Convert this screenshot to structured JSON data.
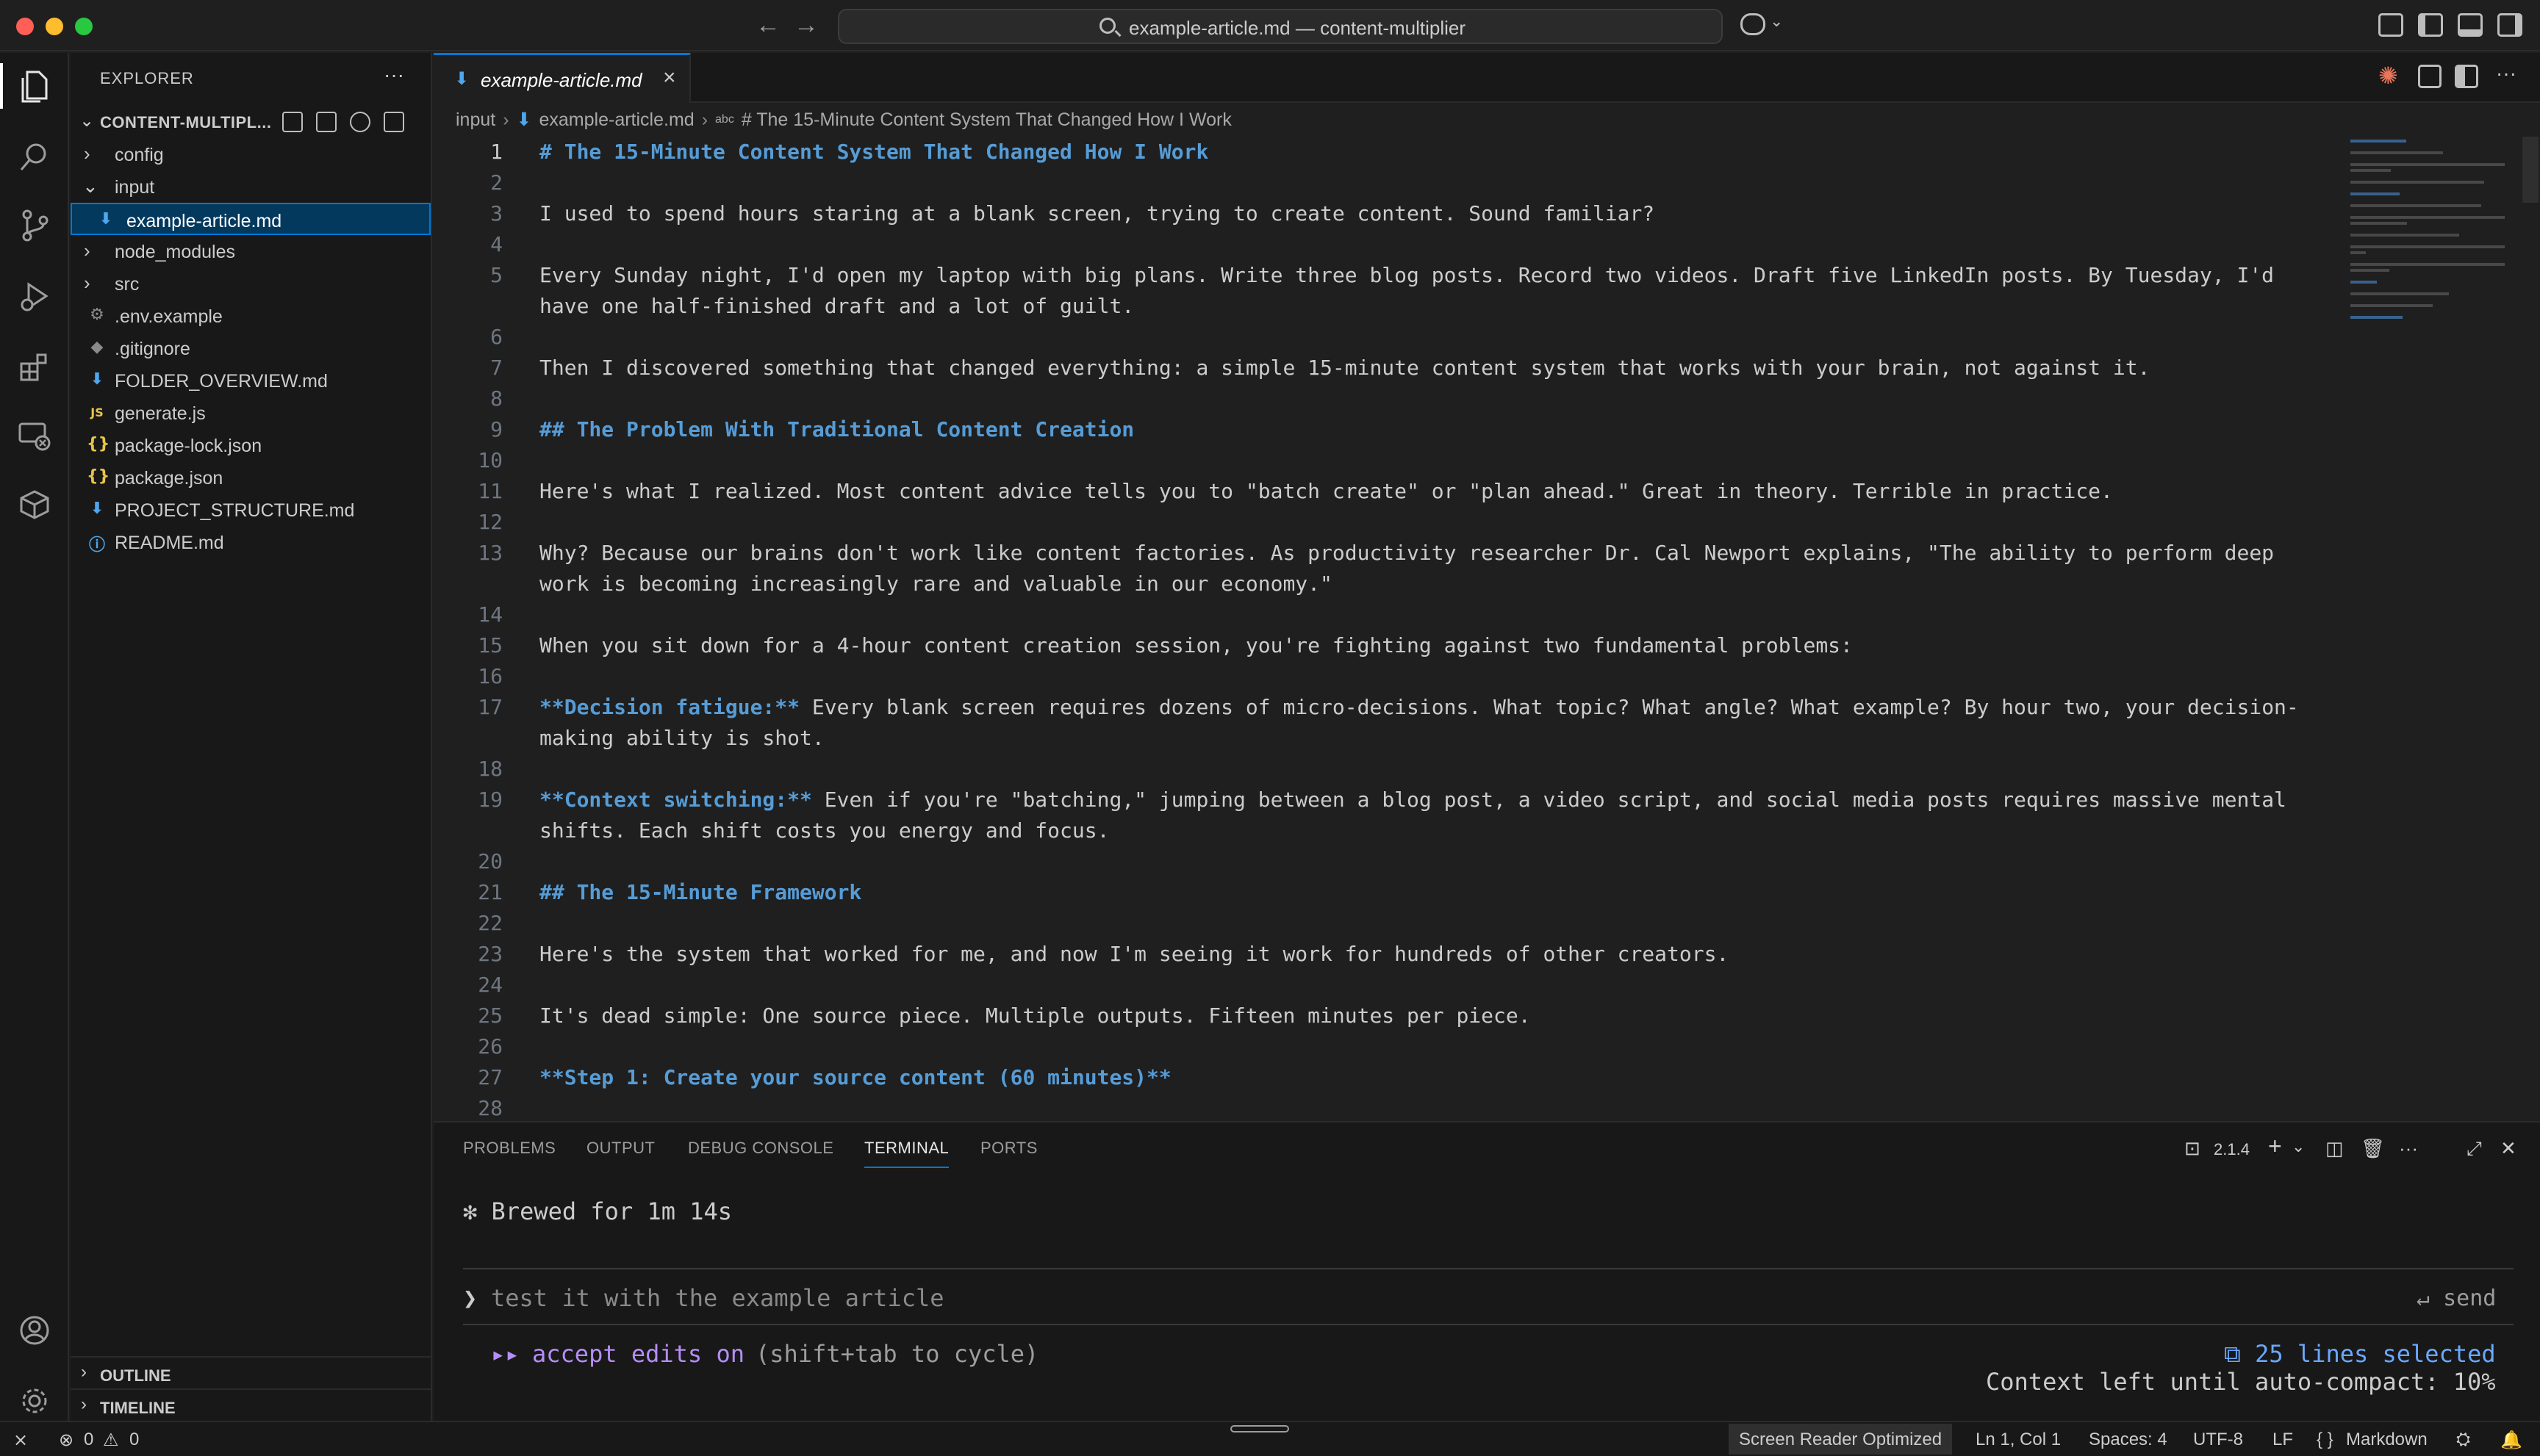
{
  "titlebar": {
    "search_text": "example-article.md — content-multiplier",
    "back": "←",
    "forward": "→"
  },
  "sidebar": {
    "title": "EXPLORER",
    "more": "···",
    "root": "CONTENT-MULTIPL...",
    "items": [
      {
        "label": "config",
        "type": "folder",
        "state": "collapsed"
      },
      {
        "label": "input",
        "type": "folder",
        "state": "expanded"
      },
      {
        "label": "example-article.md",
        "type": "markdown",
        "selected": true
      },
      {
        "label": "node_modules",
        "type": "folder",
        "state": "collapsed"
      },
      {
        "label": "src",
        "type": "folder",
        "state": "collapsed"
      },
      {
        "label": ".env.example",
        "type": "env"
      },
      {
        "label": ".gitignore",
        "type": "gitignore"
      },
      {
        "label": "FOLDER_OVERVIEW.md",
        "type": "markdown"
      },
      {
        "label": "generate.js",
        "type": "js"
      },
      {
        "label": "package-lock.json",
        "type": "json"
      },
      {
        "label": "package.json",
        "type": "json"
      },
      {
        "label": "PROJECT_STRUCTURE.md",
        "type": "markdown"
      },
      {
        "label": "README.md",
        "type": "info"
      }
    ],
    "outline": "OUTLINE",
    "timeline": "TIMELINE"
  },
  "editor": {
    "tab_label": "example-article.md",
    "breadcrumb": [
      "input",
      "example-article.md",
      "# The 15-Minute Content System That Changed How I Work"
    ],
    "active_line": 1,
    "lines": [
      {
        "n": "1",
        "text": "# The 15-Minute Content System That Changed How I Work",
        "kind": "heading"
      },
      {
        "n": "2",
        "text": ""
      },
      {
        "n": "3",
        "text": "I used to spend hours staring at a blank screen, trying to create content. Sound familiar?"
      },
      {
        "n": "4",
        "text": ""
      },
      {
        "n": "5",
        "text": "Every Sunday night, I'd open my laptop with big plans. Write three blog posts. Record two videos. Draft five LinkedIn posts. By Tuesday, I'd have one half-finished draft and a lot of guilt."
      },
      {
        "n": "6",
        "text": ""
      },
      {
        "n": "7",
        "text": "Then I discovered something that changed everything: a simple 15-minute content system that works with your brain, not against it."
      },
      {
        "n": "8",
        "text": ""
      },
      {
        "n": "9",
        "text": "## The Problem With Traditional Content Creation",
        "kind": "heading"
      },
      {
        "n": "10",
        "text": ""
      },
      {
        "n": "11",
        "text": "Here's what I realized. Most content advice tells you to \"batch create\" or \"plan ahead.\" Great in theory. Terrible in practice."
      },
      {
        "n": "12",
        "text": ""
      },
      {
        "n": "13",
        "text": "Why? Because our brains don't work like content factories. As productivity researcher Dr. Cal Newport explains, \"The ability to perform deep work is becoming increasingly rare and valuable in our economy.\""
      },
      {
        "n": "14",
        "text": ""
      },
      {
        "n": "15",
        "text": "When you sit down for a 4-hour content creation session, you're fighting against two fundamental problems:"
      },
      {
        "n": "16",
        "text": ""
      },
      {
        "n": "17",
        "bold": "**Decision fatigue:**",
        "text": " Every blank screen requires dozens of micro-decisions. What topic? What angle? What example? By hour two, your decision-making ability is shot."
      },
      {
        "n": "18",
        "text": ""
      },
      {
        "n": "19",
        "bold": "**Context switching:**",
        "text": " Even if you're \"batching,\" jumping between a blog post, a video script, and social media posts requires massive mental shifts. Each shift costs you energy and focus."
      },
      {
        "n": "20",
        "text": ""
      },
      {
        "n": "21",
        "text": "## The 15-Minute Framework",
        "kind": "heading"
      },
      {
        "n": "22",
        "text": ""
      },
      {
        "n": "23",
        "text": "Here's the system that worked for me, and now I'm seeing it work for hundreds of other creators."
      },
      {
        "n": "24",
        "text": ""
      },
      {
        "n": "25",
        "text": "It's dead simple: One source piece. Multiple outputs. Fifteen minutes per piece."
      },
      {
        "n": "26",
        "text": ""
      },
      {
        "n": "27",
        "text": "**Step 1: Create your source content (60 minutes)**",
        "kind": "heading"
      },
      {
        "n": "28",
        "text": ""
      }
    ]
  },
  "panel": {
    "tabs": [
      "PROBLEMS",
      "OUTPUT",
      "DEBUG CONSOLE",
      "TERMINAL",
      "PORTS"
    ],
    "active_tab": "TERMINAL",
    "terminal_version": "2.1.4",
    "brewed": "✻ Brewed for 1m 14s",
    "prompt_symbol": "❯",
    "prompt_text": "test it with the example article",
    "send": "↵ send",
    "mode_arrows": "▸▸",
    "mode_label": "accept edits on",
    "mode_hint": "(shift+tab to cycle)",
    "selection": "⧉ 25 lines selected",
    "context": "Context left until auto-compact: 10%"
  },
  "statusbar": {
    "remote": "⨯",
    "errors": "0",
    "warnings": "0",
    "screen_reader": "Screen Reader Optimized",
    "position": "Ln 1, Col 1",
    "spaces": "Spaces: 4",
    "encoding": "UTF-8",
    "eol": "LF",
    "language": "Markdown",
    "language_icon": "{ }"
  },
  "colors": {
    "accent": "#0078d4",
    "heading": "#569cd6",
    "terminal_purple": "#b48ef7",
    "terminal_blue": "#6aa8ff"
  }
}
